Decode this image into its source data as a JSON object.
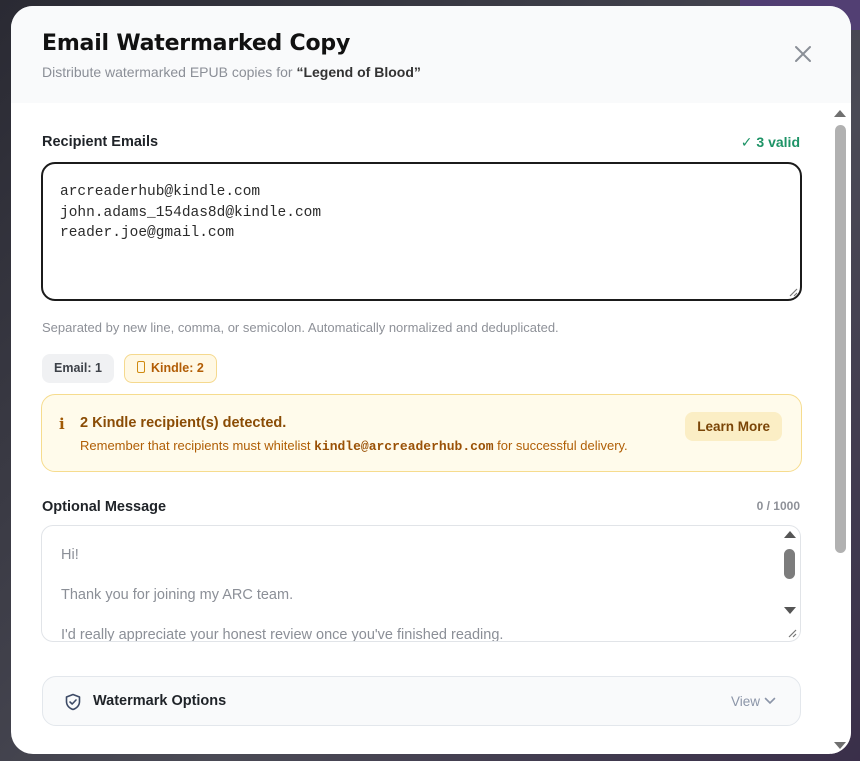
{
  "dialog": {
    "title": "Email Watermarked Copy",
    "subtitle_prefix": "Distribute watermarked EPUB copies for ",
    "book_title": "“Legend of Blood”"
  },
  "recipients": {
    "label": "Recipient Emails",
    "valid_label": "✓ 3 valid",
    "emails": [
      "arcreaderhub@kindle.com",
      "john.adams_154das8d@kindle.com",
      "reader.joe@gmail.com"
    ],
    "helper": "Separated by new line, comma, or semicolon. Automatically normalized and deduplicated.",
    "chips": {
      "email": "Email: 1",
      "kindle": "Kindle: 2"
    }
  },
  "kindle_notice": {
    "title": "2 Kindle recipient(s) detected.",
    "desc_prefix": "Remember that recipients must whitelist ",
    "address": "kindle@arcreaderhub.com",
    "desc_suffix": " for successful delivery.",
    "learn_more": "Learn More"
  },
  "message": {
    "label": "Optional Message",
    "counter": "0 / 1000",
    "lines": [
      "Hi!",
      "Thank you for joining my ARC team.",
      "I'd really appreciate your honest review once you've finished reading."
    ]
  },
  "watermark": {
    "label": "Watermark Options",
    "view": "View"
  },
  "icons": {
    "close": "close-icon",
    "info": "info-icon",
    "kindle": "kindle-icon",
    "shield": "shield-icon",
    "chevron": "chevron-down-icon"
  },
  "colors": {
    "valid_green": "#1d9366",
    "kindle_amber": "#b25d05",
    "notice_bg": "#fffbeb"
  }
}
